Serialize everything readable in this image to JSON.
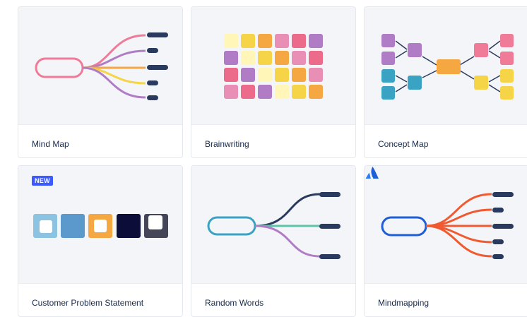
{
  "templates": [
    {
      "label": "Mind Map",
      "thumbnail": "mind-map-thumbnail"
    },
    {
      "label": "Brainwriting",
      "thumbnail": "brainwriting-thumbnail"
    },
    {
      "label": "Concept Map",
      "thumbnail": "concept-map-thumbnail"
    },
    {
      "label": "Customer Problem Statement",
      "thumbnail": "problem-statement-thumbnail",
      "badge": "NEW"
    },
    {
      "label": "Random Words",
      "thumbnail": "random-words-thumbnail"
    },
    {
      "label": "Mindmapping",
      "thumbnail": "mindmapping-thumbnail",
      "brand_icon": "atlassian-logo-icon"
    }
  ],
  "colors": {
    "pink": "#f07b98",
    "purple": "#b07cc6",
    "yellow": "#f5d547",
    "orange": "#f5a742",
    "navy": "#2a3a5e",
    "teal": "#3aa3c3",
    "mint": "#5bc4a8",
    "blue": "#1e5fd8",
    "red_orange": "#f15a30",
    "badge_blue": "#3d5afe"
  }
}
